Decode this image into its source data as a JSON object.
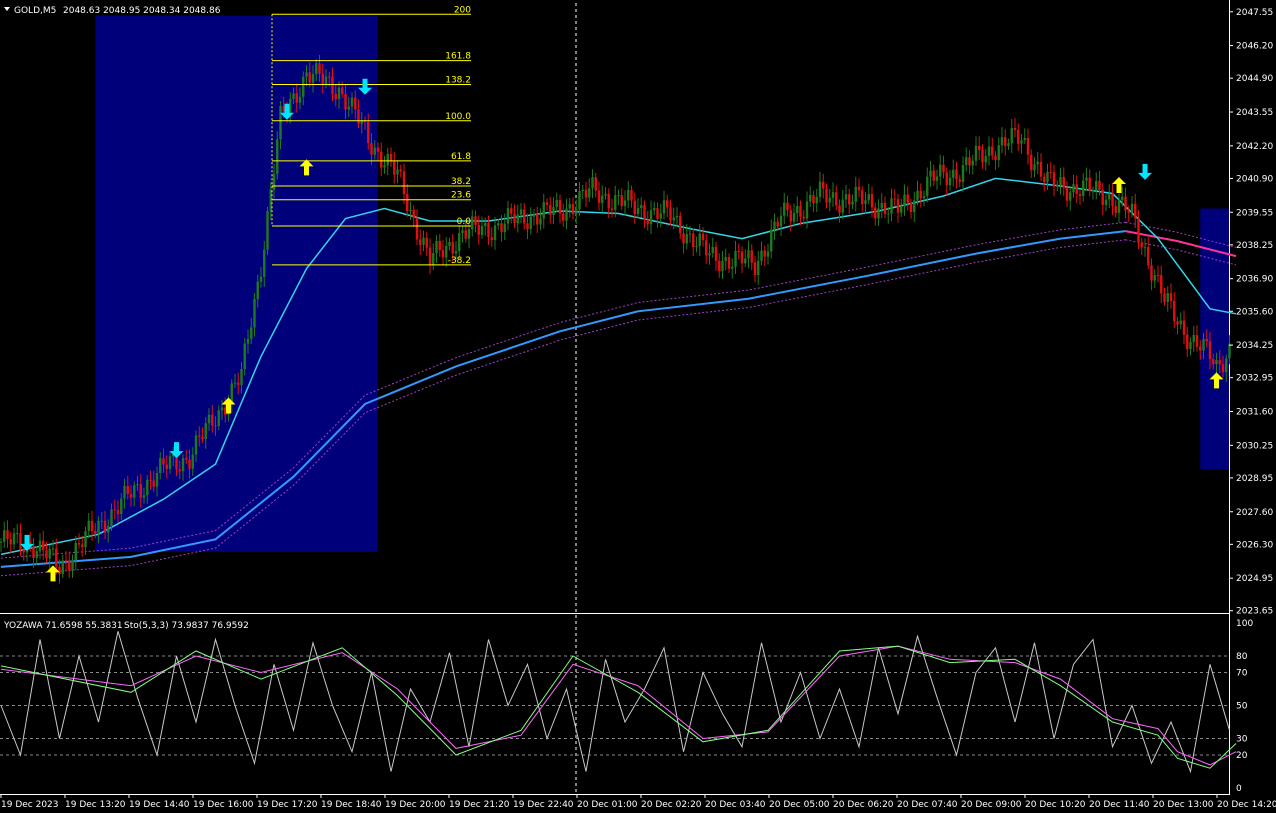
{
  "header": {
    "symbol": "GOLD,M5",
    "ohlc": "2048.63 2048.95 2048.34 2048.86"
  },
  "indicator_header": {
    "yozawa": "YOZAWA 71.6598 55.3831",
    "sto": "Sto(5,3,3) 73.9837 76.9592"
  },
  "colors": {
    "background": "#000000",
    "bull": "#1e7a1e",
    "bear": "#e01010",
    "box": "#00007a",
    "fib": "#ffff00",
    "ma_fast": "#33d6e8",
    "ma_slow": "#3399ff",
    "ma_slow_down": "#ff3399",
    "band": "#a040c8",
    "arrow_up": "#ffff00",
    "arrow_down": "#00e5ff",
    "stoch_main": "#80ff80",
    "stoch_signal": "#ff66ff",
    "yozawa": "#c8c8c8"
  },
  "chart_data": {
    "type": "candlestick",
    "price_ticks": [
      "2047.55",
      "2046.20",
      "2044.90",
      "2043.55",
      "2042.20",
      "2040.90",
      "2039.55",
      "2038.25",
      "2036.90",
      "2035.60",
      "2034.25",
      "2032.95",
      "2031.60",
      "2030.25",
      "2028.95",
      "2027.60",
      "2026.30",
      "2024.95",
      "2023.65"
    ],
    "ylim": [
      2023.6,
      2047.9
    ],
    "time_labels": [
      "19 Dec 2023",
      "19 Dec 13:20",
      "19 Dec 14:40",
      "19 Dec 16:00",
      "19 Dec 17:20",
      "19 Dec 18:40",
      "19 Dec 20:00",
      "19 Dec 21:20",
      "19 Dec 22:40",
      "20 Dec 01:00",
      "20 Dec 02:20",
      "20 Dec 03:40",
      "20 Dec 05:00",
      "20 Dec 06:20",
      "20 Dec 07:40",
      "20 Dec 09:00",
      "20 Dec 10:20",
      "20 Dec 11:40",
      "20 Dec 13:00",
      "20 Dec 14:20"
    ],
    "fib_levels": [
      {
        "label": "200",
        "price": 2047.45
      },
      {
        "label": "161.8",
        "price": 2045.6
      },
      {
        "label": "138.2",
        "price": 2044.65
      },
      {
        "label": "100.0",
        "price": 2043.2
      },
      {
        "label": "61.8",
        "price": 2041.6
      },
      {
        "label": "38.2",
        "price": 2040.6
      },
      {
        "label": "23.6",
        "price": 2040.05
      },
      {
        "label": "0.0",
        "price": 2039.0
      },
      {
        "label": "-38.2",
        "price": 2037.45
      }
    ],
    "boxes": [
      {
        "from_bar": 0.0,
        "to_bar": 0.0,
        "price_top": 2047.4,
        "price_bottom": 2026.0
      },
      {
        "from_bar": 0.0,
        "to_bar": 0.0,
        "price_top": 2039.7,
        "price_bottom": 2029.3
      }
    ],
    "price_path": [
      [
        0,
        2026.4
      ],
      [
        10,
        2026.3
      ],
      [
        18,
        2025.4
      ],
      [
        28,
        2026.8
      ],
      [
        40,
        2028.3
      ],
      [
        52,
        2029.5
      ],
      [
        58,
        2029.8
      ],
      [
        68,
        2031.8
      ],
      [
        74,
        2033.0
      ],
      [
        80,
        2037.5
      ],
      [
        86,
        2043.2
      ],
      [
        94,
        2045.1
      ],
      [
        104,
        2044.5
      ],
      [
        114,
        2042.3
      ],
      [
        122,
        2041.0
      ],
      [
        132,
        2037.6
      ],
      [
        142,
        2038.7
      ],
      [
        152,
        2039.0
      ],
      [
        162,
        2039.4
      ],
      [
        172,
        2039.6
      ],
      [
        182,
        2040.4
      ],
      [
        196,
        2039.7
      ],
      [
        206,
        2039.4
      ],
      [
        218,
        2037.8
      ],
      [
        232,
        2037.5
      ],
      [
        240,
        2039.3
      ],
      [
        252,
        2040.2
      ],
      [
        266,
        2040.0
      ],
      [
        276,
        2039.6
      ],
      [
        286,
        2040.8
      ],
      [
        296,
        2041.3
      ],
      [
        306,
        2042.2
      ],
      [
        314,
        2042.5
      ],
      [
        322,
        2040.7
      ],
      [
        332,
        2040.5
      ],
      [
        340,
        2040.3
      ],
      [
        348,
        2039.4
      ],
      [
        358,
        2036.0
      ],
      [
        366,
        2034.5
      ],
      [
        372,
        2033.8
      ],
      [
        374,
        2033.4
      ],
      [
        380,
        2034.5
      ]
    ],
    "ma_fast": [
      [
        0,
        2025.9
      ],
      [
        30,
        2026.7
      ],
      [
        50,
        2028.1
      ],
      [
        66,
        2029.5
      ],
      [
        80,
        2033.8
      ],
      [
        94,
        2037.3
      ],
      [
        106,
        2039.3
      ],
      [
        118,
        2039.7
      ],
      [
        132,
        2039.2
      ],
      [
        150,
        2039.2
      ],
      [
        172,
        2039.6
      ],
      [
        190,
        2039.5
      ],
      [
        212,
        2038.9
      ],
      [
        228,
        2038.5
      ],
      [
        246,
        2039.1
      ],
      [
        270,
        2039.6
      ],
      [
        290,
        2040.2
      ],
      [
        306,
        2040.9
      ],
      [
        326,
        2040.6
      ],
      [
        342,
        2040.3
      ],
      [
        356,
        2038.5
      ],
      [
        372,
        2035.7
      ],
      [
        380,
        2035.5
      ]
    ],
    "ma_slow": [
      [
        0,
        2025.4
      ],
      [
        40,
        2025.8
      ],
      [
        66,
        2026.5
      ],
      [
        90,
        2029.0
      ],
      [
        112,
        2031.9
      ],
      [
        140,
        2033.4
      ],
      [
        172,
        2034.8
      ],
      [
        196,
        2035.6
      ],
      [
        230,
        2036.1
      ],
      [
        266,
        2037.0
      ],
      [
        300,
        2037.9
      ],
      [
        326,
        2038.5
      ],
      [
        346,
        2038.8
      ]
    ],
    "ma_slow_down": [
      [
        346,
        2038.8
      ],
      [
        362,
        2038.4
      ],
      [
        380,
        2037.8
      ]
    ],
    "ma_band_offset": 0.35,
    "arrows": [
      {
        "bar": 8,
        "dir": "down",
        "price": 2026.4
      },
      {
        "bar": 16,
        "dir": "up",
        "price": 2025.1
      },
      {
        "bar": 54,
        "dir": "down",
        "price": 2030.1
      },
      {
        "bar": 70,
        "dir": "up",
        "price": 2031.8
      },
      {
        "bar": 88,
        "dir": "down",
        "price": 2043.6
      },
      {
        "bar": 94,
        "dir": "up",
        "price": 2041.3
      },
      {
        "bar": 112,
        "dir": "down",
        "price": 2044.6
      },
      {
        "bar": 344,
        "dir": "up",
        "price": 2040.6
      },
      {
        "bar": 352,
        "dir": "down",
        "price": 2041.2
      },
      {
        "bar": 374,
        "dir": "up",
        "price": 2032.8
      }
    ]
  },
  "oscillator": {
    "levels": [
      "100",
      "80",
      "70",
      "50",
      "30",
      "20",
      "0"
    ],
    "stoch_main": [
      [
        0,
        74
      ],
      [
        40,
        58
      ],
      [
        60,
        83
      ],
      [
        80,
        66
      ],
      [
        105,
        85
      ],
      [
        122,
        56
      ],
      [
        140,
        20
      ],
      [
        160,
        35
      ],
      [
        176,
        80
      ],
      [
        196,
        58
      ],
      [
        216,
        28
      ],
      [
        236,
        35
      ],
      [
        258,
        83
      ],
      [
        276,
        86
      ],
      [
        292,
        76
      ],
      [
        312,
        78
      ],
      [
        326,
        62
      ],
      [
        342,
        40
      ],
      [
        356,
        32
      ],
      [
        362,
        18
      ],
      [
        372,
        12
      ],
      [
        380,
        27
      ]
    ],
    "stoch_signal": [
      [
        0,
        72
      ],
      [
        40,
        62
      ],
      [
        60,
        80
      ],
      [
        80,
        70
      ],
      [
        105,
        82
      ],
      [
        122,
        60
      ],
      [
        140,
        24
      ],
      [
        160,
        32
      ],
      [
        176,
        75
      ],
      [
        196,
        62
      ],
      [
        216,
        30
      ],
      [
        236,
        34
      ],
      [
        258,
        80
      ],
      [
        276,
        86
      ],
      [
        292,
        78
      ],
      [
        312,
        76
      ],
      [
        326,
        66
      ],
      [
        342,
        42
      ],
      [
        356,
        36
      ],
      [
        362,
        22
      ],
      [
        372,
        14
      ],
      [
        380,
        22
      ]
    ],
    "yozawa": [
      [
        0,
        50
      ],
      [
        6,
        20
      ],
      [
        12,
        90
      ],
      [
        18,
        30
      ],
      [
        24,
        80
      ],
      [
        30,
        40
      ],
      [
        36,
        95
      ],
      [
        42,
        55
      ],
      [
        48,
        20
      ],
      [
        54,
        80
      ],
      [
        60,
        40
      ],
      [
        66,
        90
      ],
      [
        72,
        50
      ],
      [
        78,
        15
      ],
      [
        84,
        75
      ],
      [
        90,
        35
      ],
      [
        96,
        88
      ],
      [
        102,
        50
      ],
      [
        108,
        22
      ],
      [
        114,
        70
      ],
      [
        120,
        10
      ],
      [
        126,
        60
      ],
      [
        132,
        40
      ],
      [
        138,
        82
      ],
      [
        144,
        25
      ],
      [
        150,
        90
      ],
      [
        156,
        50
      ],
      [
        162,
        75
      ],
      [
        168,
        30
      ],
      [
        174,
        60
      ],
      [
        180,
        10
      ],
      [
        186,
        78
      ],
      [
        192,
        40
      ],
      [
        198,
        60
      ],
      [
        204,
        85
      ],
      [
        210,
        22
      ],
      [
        216,
        70
      ],
      [
        222,
        45
      ],
      [
        228,
        25
      ],
      [
        234,
        88
      ],
      [
        240,
        40
      ],
      [
        246,
        70
      ],
      [
        252,
        30
      ],
      [
        258,
        60
      ],
      [
        264,
        25
      ],
      [
        270,
        85
      ],
      [
        276,
        45
      ],
      [
        282,
        92
      ],
      [
        288,
        55
      ],
      [
        294,
        20
      ],
      [
        300,
        70
      ],
      [
        306,
        85
      ],
      [
        312,
        40
      ],
      [
        318,
        88
      ],
      [
        324,
        30
      ],
      [
        330,
        75
      ],
      [
        336,
        90
      ],
      [
        342,
        25
      ],
      [
        348,
        50
      ],
      [
        354,
        15
      ],
      [
        360,
        40
      ],
      [
        366,
        10
      ],
      [
        372,
        75
      ],
      [
        378,
        35
      ]
    ]
  }
}
